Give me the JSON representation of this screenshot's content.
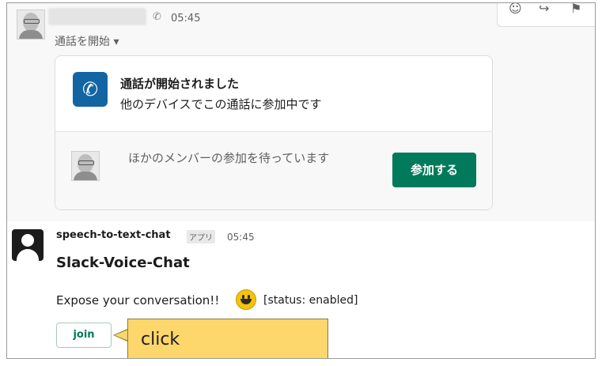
{
  "call_message": {
    "time": "05:45",
    "call_start_label": "通話を開始 ▾",
    "phone_icon": "phone-icon"
  },
  "call_card": {
    "title": "通話が開始されました",
    "subtitle": "他のデバイスでこの通話に参加中です",
    "waiting_text": "ほかのメンバーの参加を待っています",
    "join_button_label": "参加する",
    "icon": "phone-icon",
    "accent_color": "#1264a3",
    "join_color": "#007a5a"
  },
  "toolbar": {
    "icons": [
      "emoji-icon",
      "share-icon",
      "bookmark-icon"
    ]
  },
  "bot_message": {
    "sender": "speech-to-text-chat",
    "badge": "アプリ",
    "time": "05:45",
    "title": "Slack-Voice-Chat",
    "text": "Expose your conversation!!",
    "status": "[status: enabled]",
    "join_label": "join"
  },
  "annotation": {
    "callout_text": "click",
    "callout_color": "#fdd66c"
  }
}
